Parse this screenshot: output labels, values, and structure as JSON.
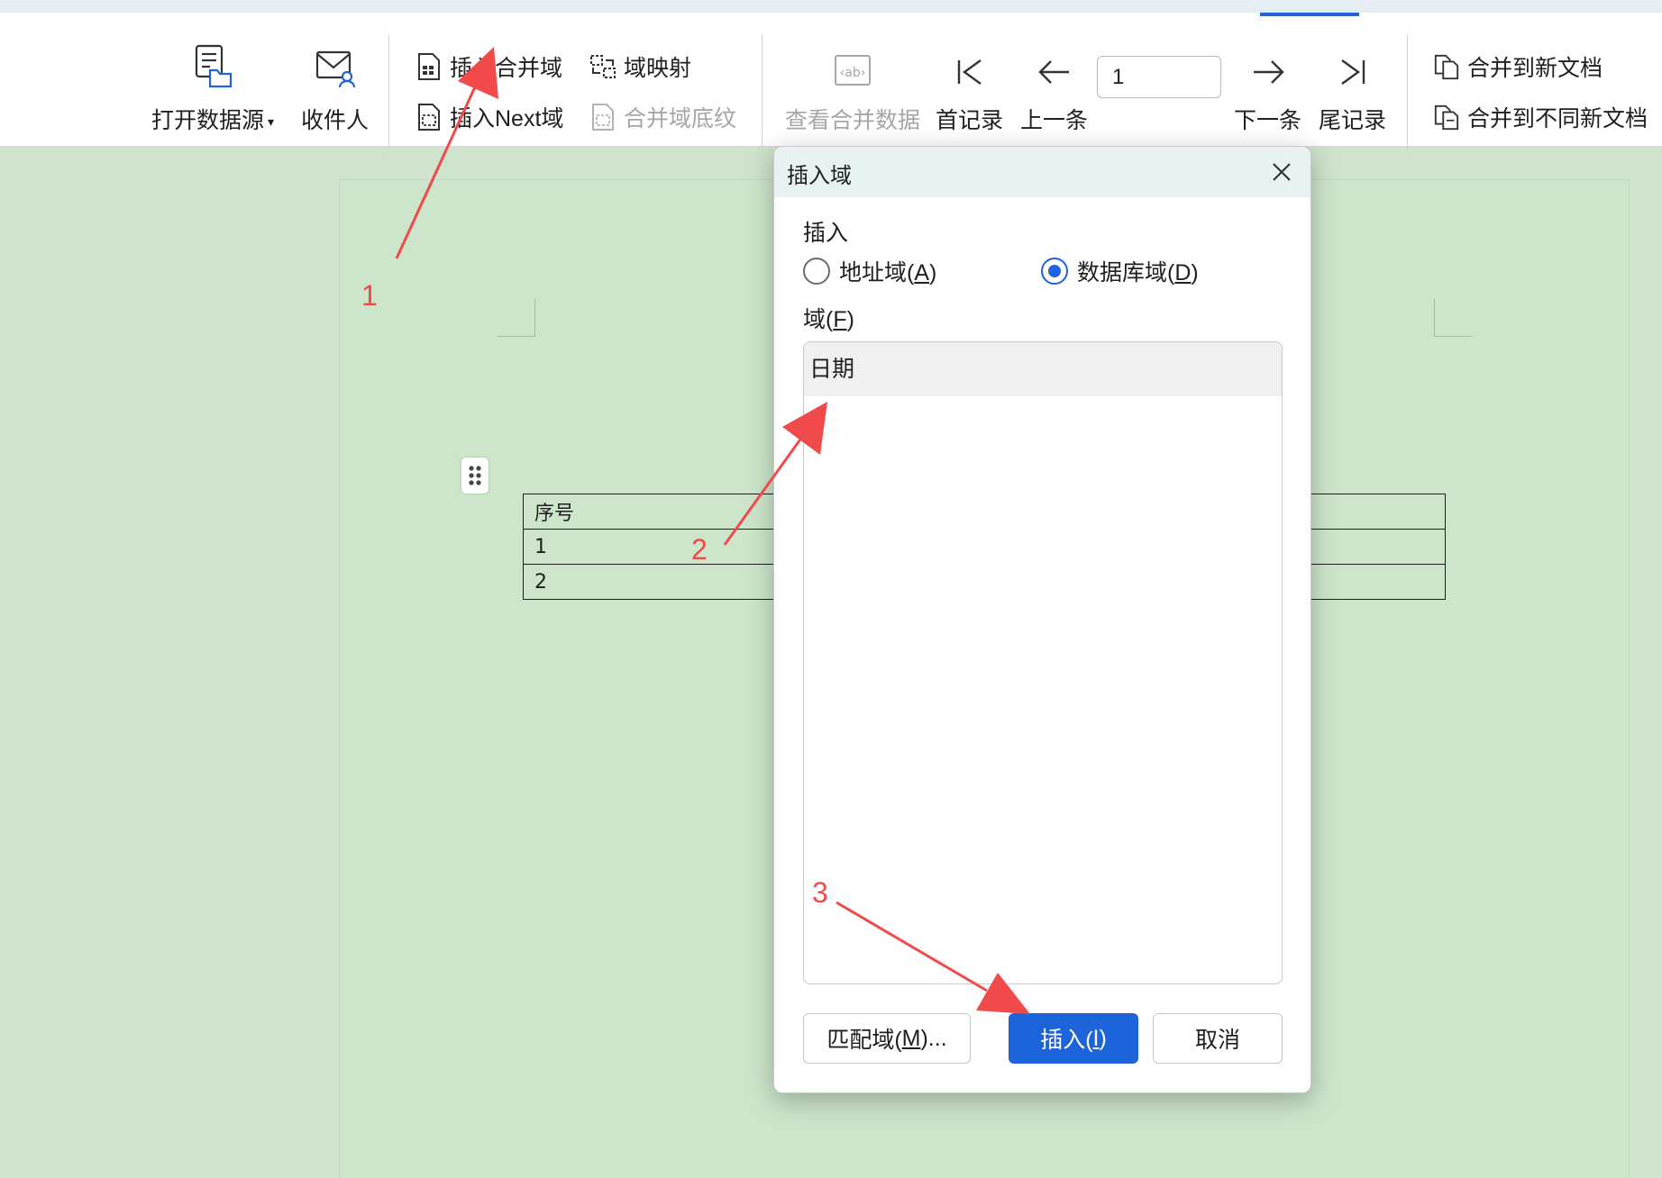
{
  "ribbon": {
    "open_data_source": "打开数据源",
    "recipients": "收件人",
    "insert_merge_field": "插入合并域",
    "insert_next_field": "插入Next域",
    "field_mapping": "域映射",
    "merge_field_shading": "合并域底纹",
    "view_merged_data": "查看合并数据",
    "first_record": "首记录",
    "previous_record": "上一条",
    "record_number": "1",
    "next_record": "下一条",
    "last_record": "尾记录",
    "merge_to_new_document": "合并到新文档",
    "merge_to_different_new_documents": "合并到不同新文档"
  },
  "document": {
    "table": {
      "rows": [
        [
          "序号",
          ""
        ],
        [
          "1",
          ""
        ],
        [
          "2",
          ""
        ]
      ]
    }
  },
  "dialog": {
    "title": "插入域",
    "insert_group_label": "插入",
    "radio_address": {
      "text": "地址域(",
      "key": "A",
      "tail": ")",
      "checked": false
    },
    "radio_database": {
      "text": "数据库域(",
      "key": "D",
      "tail": ")",
      "checked": true
    },
    "field_label": {
      "text": "域(",
      "key": "F",
      "tail": ")"
    },
    "fields": [
      "日期"
    ],
    "match_fields_button": {
      "text": "匹配域(",
      "key": "M",
      "tail": ")..."
    },
    "insert_button": {
      "text": "插入(",
      "key": "I",
      "tail": ")"
    },
    "cancel_button": "取消"
  },
  "annotations": {
    "step1": "1",
    "step2": "2",
    "step3": "3",
    "color": "#f04a4a"
  },
  "colors": {
    "accent": "#1d63d9",
    "document_background": "#cde6cb",
    "dialog_titlebar": "#e9f2f3"
  }
}
